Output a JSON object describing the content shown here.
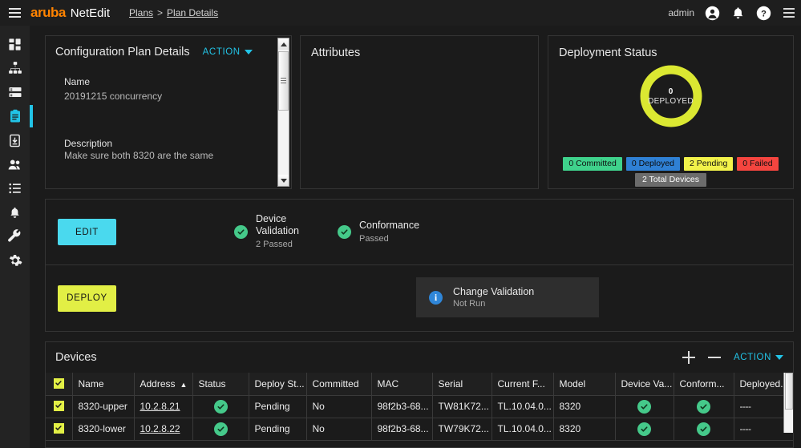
{
  "topbar": {
    "menu_icon": "hamburger-icon",
    "brand_primary": "aruba",
    "brand_secondary": "NetEdit",
    "breadcrumb_root": "Plans",
    "breadcrumb_sep": ">",
    "breadcrumb_current": "Plan Details",
    "username": "admin",
    "icons": [
      "user-icon",
      "bell-icon",
      "help-icon",
      "app-menu-icon"
    ]
  },
  "sidebar": {
    "items": [
      {
        "name": "dashboard",
        "icon": "dashboard-icon",
        "active": false
      },
      {
        "name": "topology",
        "icon": "topology-icon",
        "active": false
      },
      {
        "name": "inventory",
        "icon": "list-lines-icon",
        "active": false
      },
      {
        "name": "plans",
        "icon": "clipboard-icon",
        "active": true
      },
      {
        "name": "deploy",
        "icon": "download-device-icon",
        "active": false
      },
      {
        "name": "users",
        "icon": "users-icon",
        "active": false
      },
      {
        "name": "logs",
        "icon": "bullet-list-icon",
        "active": false
      },
      {
        "name": "alerts",
        "icon": "bell-icon",
        "active": false
      },
      {
        "name": "tools",
        "icon": "wrench-icon",
        "active": false
      },
      {
        "name": "settings",
        "icon": "gear-icon",
        "active": false
      }
    ]
  },
  "plan_card": {
    "title": "Configuration Plan Details",
    "action_label": "ACTION",
    "name_label": "Name",
    "name_value": "20191215 concurrency",
    "description_label": "Description",
    "description_value": "Make sure both 8320 are the same"
  },
  "attributes_card": {
    "title": "Attributes"
  },
  "deployment_card": {
    "title": "Deployment Status",
    "donut_value": "0",
    "donut_label": "DEPLOYED",
    "legend": [
      {
        "label": "0 Committed",
        "color": "#3fd28c"
      },
      {
        "label": "0 Deployed",
        "color": "#2f80d4"
      },
      {
        "label": "2 Pending",
        "color": "#f2f24a"
      },
      {
        "label": "0 Failed",
        "color": "#f5453f"
      }
    ],
    "total_label": "2 Total Devices",
    "ring_color": "#dbe832"
  },
  "validation": {
    "edit_button": "EDIT",
    "deploy_button": "DEPLOY",
    "device_validation_name": "Device Validation",
    "device_validation_sub": "2 Passed",
    "conformance_name": "Conformance",
    "conformance_sub": "Passed",
    "change_validation_name": "Change Validation",
    "change_validation_sub": "Not Run"
  },
  "devices": {
    "title": "Devices",
    "add_label": "add-row",
    "remove_label": "remove-row",
    "action_label": "ACTION",
    "sort_column": "Address",
    "sort_direction": "asc",
    "columns": [
      "Name",
      "Address",
      "Status",
      "Deploy St...",
      "Committed",
      "MAC",
      "Serial",
      "Current F...",
      "Model",
      "Device Va...",
      "Conform...",
      "Deployed."
    ],
    "rows": [
      {
        "selected": true,
        "name": "8320-upper",
        "address": "10.2.8.21",
        "status": "passed",
        "deploy_status": "Pending",
        "committed": "No",
        "mac": "98f2b3-68...",
        "serial": "TW81K72...",
        "current_firmware": "TL.10.04.0...",
        "model": "8320",
        "device_validation": "passed",
        "conformance": "passed",
        "deployed": "----"
      },
      {
        "selected": true,
        "name": "8320-lower",
        "address": "10.2.8.22",
        "status": "passed",
        "deploy_status": "Pending",
        "committed": "No",
        "mac": "98f2b3-68...",
        "serial": "TW79K72...",
        "current_firmware": "TL.10.04.0...",
        "model": "8320",
        "device_validation": "passed",
        "conformance": "passed",
        "deployed": "----"
      }
    ]
  }
}
